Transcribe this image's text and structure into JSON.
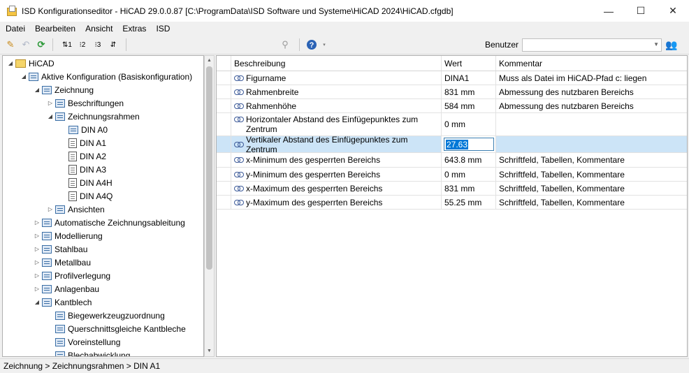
{
  "window": {
    "title": "ISD Konfigurationseditor  - HiCAD 29.0.0.87 [C:\\ProgramData\\ISD Software und Systeme\\HiCAD 2024\\HiCAD.cfgdb]",
    "minimize": "—",
    "maximize": "☐",
    "close": "✕"
  },
  "menu": {
    "items": [
      "Datei",
      "Bearbeiten",
      "Ansicht",
      "Extras",
      "ISD"
    ]
  },
  "toolbar": {
    "user_label": "Benutzer",
    "user_value": ""
  },
  "tree": {
    "items": [
      {
        "label": "HiCAD",
        "expander": "◢",
        "icon": "folder-icon"
      },
      {
        "label": "Aktive Konfiguration (Basiskonfiguration)",
        "expander": "◢",
        "icon": "config-icon"
      },
      {
        "label": "Zeichnung",
        "expander": "◢",
        "icon": "table-icon"
      },
      {
        "label": "Beschriftungen",
        "expander": "▷",
        "icon": "table-icon"
      },
      {
        "label": "Zeichnungsrahmen",
        "expander": "◢",
        "icon": "table-icon"
      },
      {
        "label": "DIN A0",
        "expander": "",
        "icon": "sheet-icon"
      },
      {
        "label": "DIN A1",
        "expander": "",
        "icon": "sheet-icon"
      },
      {
        "label": "DIN A2",
        "expander": "",
        "icon": "sheet-icon"
      },
      {
        "label": "DIN A3",
        "expander": "",
        "icon": "sheet-icon"
      },
      {
        "label": "DIN A4H",
        "expander": "",
        "icon": "sheet-icon"
      },
      {
        "label": "DIN A4Q",
        "expander": "",
        "icon": "sheet-icon"
      },
      {
        "label": "Ansichten",
        "expander": "▷",
        "icon": "table-icon"
      },
      {
        "label": "Automatische Zeichnungsableitung",
        "expander": "▷",
        "icon": "table-icon"
      },
      {
        "label": "Modellierung",
        "expander": "▷",
        "icon": "table-icon"
      },
      {
        "label": "Stahlbau",
        "expander": "▷",
        "icon": "table-icon"
      },
      {
        "label": "Metallbau",
        "expander": "▷",
        "icon": "table-icon"
      },
      {
        "label": "Profilverlegung",
        "expander": "▷",
        "icon": "table-icon"
      },
      {
        "label": "Anlagenbau",
        "expander": "▷",
        "icon": "table-icon"
      },
      {
        "label": "Kantblech",
        "expander": "◢",
        "icon": "table-icon"
      },
      {
        "label": "Biegewerkzeugzuordnung",
        "expander": "",
        "icon": "table-icon"
      },
      {
        "label": "Querschnittsgleiche Kantbleche",
        "expander": "",
        "icon": "table-icon"
      },
      {
        "label": "Voreinstellung",
        "expander": "",
        "icon": "table-icon"
      },
      {
        "label": "Blechabwicklung",
        "expander": "",
        "icon": "table-icon"
      }
    ]
  },
  "grid": {
    "columns": [
      "Beschreibung",
      "Wert",
      "Kommentar"
    ],
    "rows": [
      {
        "desc": "Figurname",
        "value": "DINA1",
        "comment": "Muss als Datei im HiCAD-Pfad c: liegen"
      },
      {
        "desc": "Rahmenbreite",
        "value": "831 mm",
        "comment": "Abmessung des nutzbaren Bereichs"
      },
      {
        "desc": "Rahmenhöhe",
        "value": "584 mm",
        "comment": "Abmessung des nutzbaren Bereichs"
      },
      {
        "desc": "Horizontaler Abstand des Einfügepunktes zum Zentrum",
        "value": "0 mm",
        "comment": ""
      },
      {
        "desc": "Vertikaler Abstand des Einfügepunktes zum Zentrum",
        "value": "27.63",
        "comment": ""
      },
      {
        "desc": "x-Minimum des gesperrten Bereichs",
        "value": "643.8 mm",
        "comment": "Schriftfeld, Tabellen, Kommentare"
      },
      {
        "desc": "y-Minimum des gesperrten Bereichs",
        "value": "0 mm",
        "comment": "Schriftfeld, Tabellen, Kommentare"
      },
      {
        "desc": "x-Maximum des gesperrten Bereichs",
        "value": "831 mm",
        "comment": "Schriftfeld, Tabellen, Kommentare"
      },
      {
        "desc": "y-Maximum des gesperrten Bereichs",
        "value": "55.25 mm",
        "comment": "Schriftfeld, Tabellen, Kommentare"
      }
    ]
  },
  "status": {
    "breadcrumb": "Zeichnung > Zeichnungsrahmen > DIN A1"
  }
}
